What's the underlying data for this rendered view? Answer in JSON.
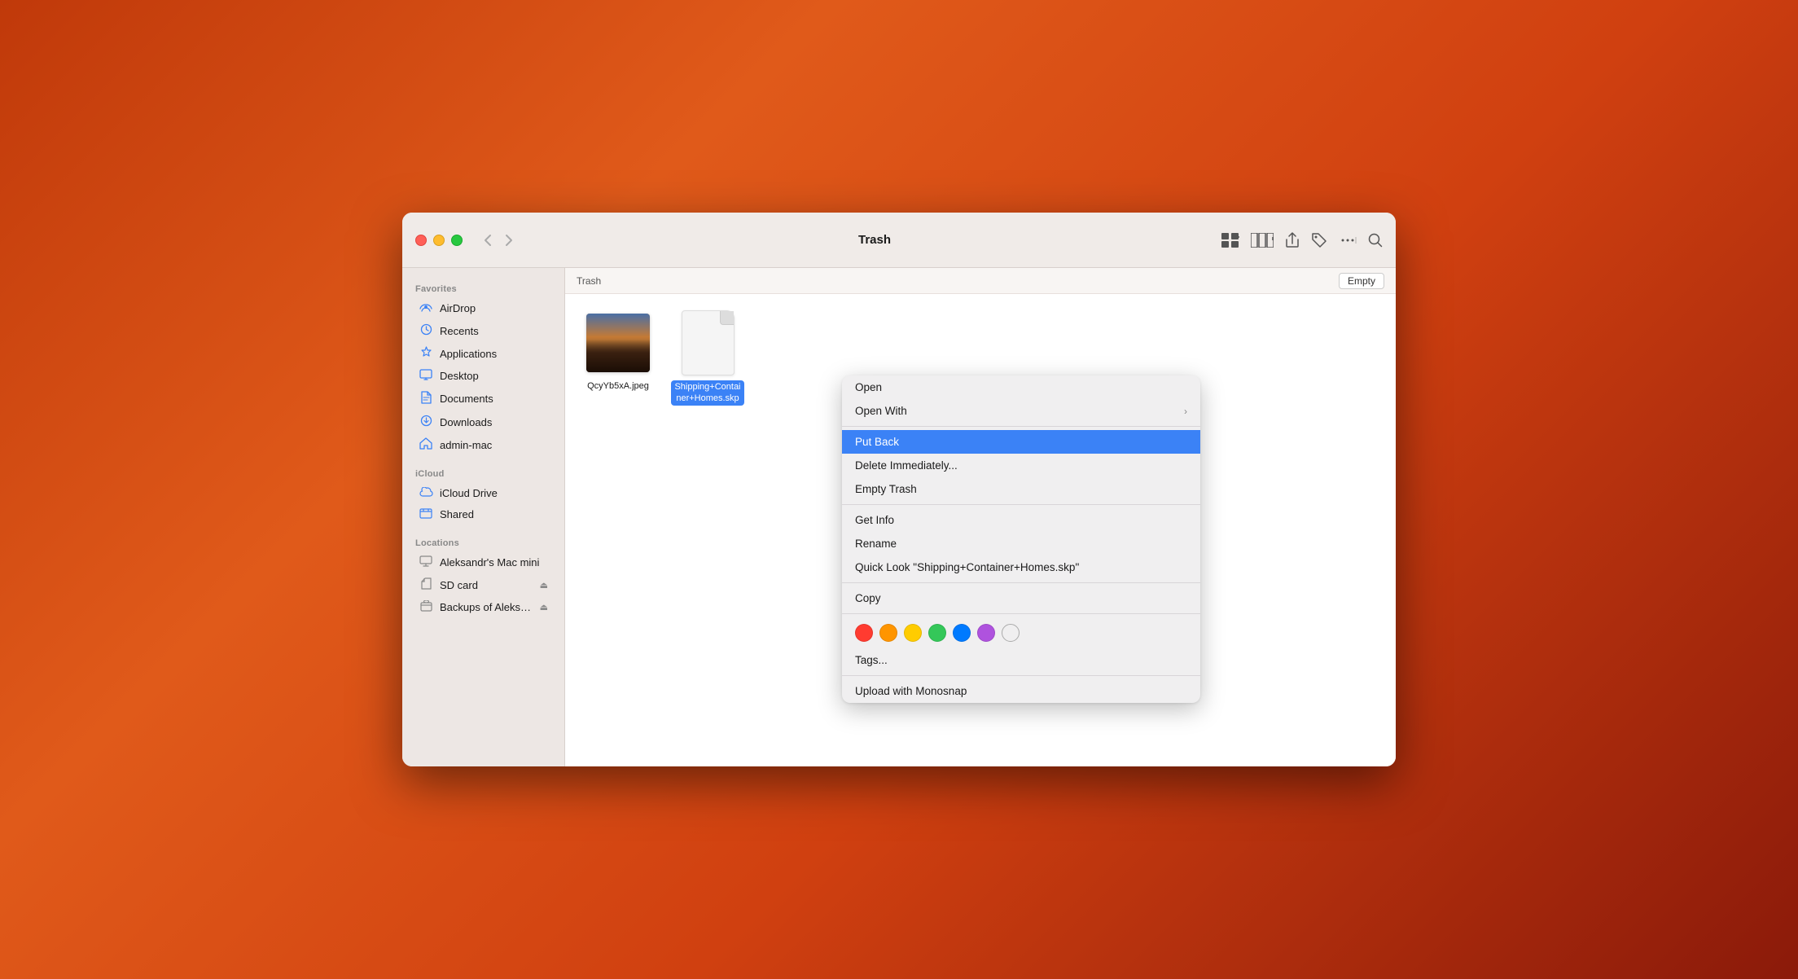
{
  "window": {
    "title": "Trash"
  },
  "toolbar": {
    "back_label": "‹",
    "forward_label": "›",
    "title": "Trash",
    "empty_button": "Empty"
  },
  "sidebar": {
    "sections": [
      {
        "label": "Favorites",
        "items": [
          {
            "id": "airdrop",
            "label": "AirDrop",
            "icon": "airdrop"
          },
          {
            "id": "recents",
            "label": "Recents",
            "icon": "recents"
          },
          {
            "id": "applications",
            "label": "Applications",
            "icon": "applications"
          },
          {
            "id": "desktop",
            "label": "Desktop",
            "icon": "desktop"
          },
          {
            "id": "documents",
            "label": "Documents",
            "icon": "documents"
          },
          {
            "id": "downloads",
            "label": "Downloads",
            "icon": "downloads"
          },
          {
            "id": "admin-mac",
            "label": "admin-mac",
            "icon": "home"
          }
        ]
      },
      {
        "label": "iCloud",
        "items": [
          {
            "id": "icloud-drive",
            "label": "iCloud Drive",
            "icon": "icloud"
          },
          {
            "id": "shared",
            "label": "Shared",
            "icon": "shared"
          }
        ]
      },
      {
        "label": "Locations",
        "items": [
          {
            "id": "mac-mini",
            "label": "Aleksandr's Mac mini",
            "icon": "mac",
            "eject": false
          },
          {
            "id": "sd-card",
            "label": "SD card",
            "icon": "sdcard",
            "eject": true
          },
          {
            "id": "backups",
            "label": "Backups of Aleksa...",
            "icon": "backup",
            "eject": true
          }
        ]
      }
    ]
  },
  "path_bar": {
    "label": "Trash"
  },
  "files": [
    {
      "id": "jpeg-file",
      "name": "QcyYb5xA.jpeg",
      "type": "jpeg",
      "selected": false
    },
    {
      "id": "skp-file",
      "name": "Shipping+Container+Homes.skp",
      "name_display_line1": "Shipping+Contain",
      "name_display_line2": "er+Homes.skp",
      "type": "generic",
      "selected": true
    }
  ],
  "context_menu": {
    "items": [
      {
        "id": "open",
        "label": "Open",
        "type": "item",
        "has_arrow": false
      },
      {
        "id": "open-with",
        "label": "Open With",
        "type": "item",
        "has_arrow": true
      },
      {
        "id": "divider1",
        "type": "divider"
      },
      {
        "id": "put-back",
        "label": "Put Back",
        "type": "item",
        "highlighted": true,
        "has_arrow": false
      },
      {
        "id": "delete-immediately",
        "label": "Delete Immediately...",
        "type": "item",
        "has_arrow": false
      },
      {
        "id": "empty-trash",
        "label": "Empty Trash",
        "type": "item",
        "has_arrow": false
      },
      {
        "id": "divider2",
        "type": "divider"
      },
      {
        "id": "get-info",
        "label": "Get Info",
        "type": "item",
        "has_arrow": false
      },
      {
        "id": "rename",
        "label": "Rename",
        "type": "item",
        "has_arrow": false
      },
      {
        "id": "quick-look",
        "label": "Quick Look \"Shipping+Container+Homes.skp\"",
        "type": "item",
        "has_arrow": false
      },
      {
        "id": "divider3",
        "type": "divider"
      },
      {
        "id": "copy",
        "label": "Copy",
        "type": "item",
        "has_arrow": false
      },
      {
        "id": "divider4",
        "type": "divider"
      },
      {
        "id": "tags-colors",
        "type": "colors"
      },
      {
        "id": "tags",
        "label": "Tags...",
        "type": "item",
        "has_arrow": false
      },
      {
        "id": "divider5",
        "type": "divider"
      },
      {
        "id": "upload-monosnap",
        "label": "Upload with Monosnap",
        "type": "item",
        "has_arrow": false
      }
    ],
    "tag_colors": [
      {
        "id": "red",
        "color": "#ff3b30"
      },
      {
        "id": "orange",
        "color": "#ff9500"
      },
      {
        "id": "yellow",
        "color": "#ffcc00"
      },
      {
        "id": "green",
        "color": "#34c759"
      },
      {
        "id": "blue",
        "color": "#007aff"
      },
      {
        "id": "purple",
        "color": "#af52de"
      },
      {
        "id": "outline",
        "color": "outline"
      }
    ]
  }
}
